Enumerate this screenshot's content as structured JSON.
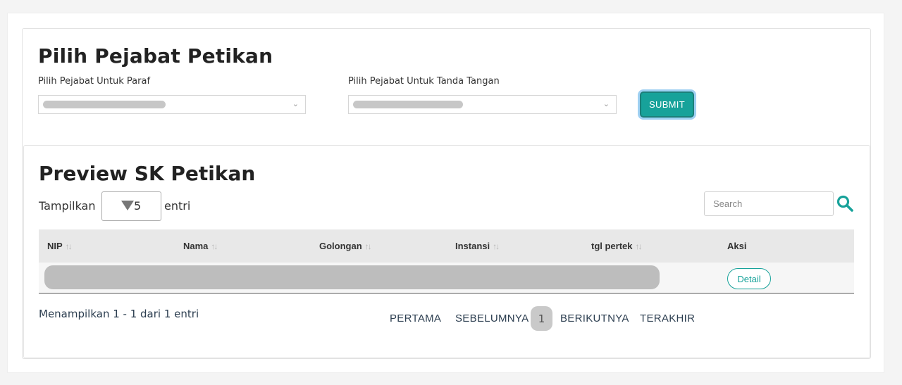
{
  "form": {
    "title": "Pilih Pejabat Petikan",
    "paraf_label": "Pilih Pejabat Untuk Paraf",
    "tanda_tangan_label": "Pilih Pejabat Untuk Tanda Tangan",
    "submit_label": "SUBMIT"
  },
  "preview": {
    "title": "Preview SK Petikan",
    "show_label": "Tampilkan",
    "show_value": "5",
    "entries_label": "entri",
    "search_placeholder": "Search",
    "columns": [
      "NIP",
      "Nama",
      "Golongan",
      "Instansi",
      "tgl pertek",
      "Aksi"
    ],
    "sort_glyph": "↑↓",
    "row_action_label": "Detail",
    "info_text": "Menampilkan 1 - 1 dari 1 entri",
    "pagination": {
      "first": "PERTAMA",
      "prev": "SEBELUMNYA",
      "current": "1",
      "next": "BERIKUTNYA",
      "last": "TERAKHIR"
    }
  },
  "colors": {
    "accent": "#17a29a",
    "header_bg": "#e8e8e8",
    "redaction": "#bdbdbd"
  },
  "icons": {
    "search": "search-icon",
    "dropdown": "chevron-down-icon",
    "sort": "sort-icon"
  }
}
